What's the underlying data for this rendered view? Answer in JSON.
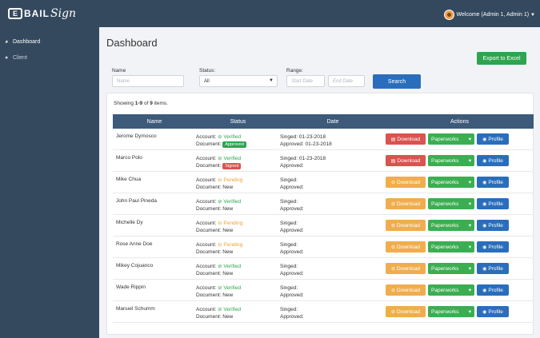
{
  "header": {
    "logo_mark": "E",
    "logo_text": "BAIL",
    "logo_script": "Sign",
    "welcome": "Welcome (Admin 1, Admin 1)"
  },
  "sidebar": {
    "items": [
      {
        "label": "Dashboard",
        "icon": "dashboard-icon"
      },
      {
        "label": "Client",
        "icon": "user-icon"
      }
    ]
  },
  "main": {
    "title": "Dashboard",
    "export_label": "Export to Excel",
    "filters": {
      "name_label": "Name",
      "name_placeholder": "Name",
      "status_label": "Status:",
      "status_value": "All",
      "range_label": "Range:",
      "start_placeholder": "Start Date",
      "end_placeholder": "End Date",
      "search_label": "Search"
    },
    "showing": {
      "prefix": "Showing ",
      "range": "1-9",
      "mid": " of ",
      "total": "9",
      "suffix": " items."
    },
    "table": {
      "columns": [
        "Name",
        "Status",
        "Date",
        "Actions"
      ],
      "account_label": "Account:",
      "document_label": "Document:",
      "singed_label": "Singed:",
      "approved_label": "Approved:",
      "download_label": "Download",
      "paperworks_label": "Paperworks",
      "profile_label": "Profile",
      "rows": [
        {
          "name": "Jerome Dymosco",
          "account": "Verified",
          "account_state": "ok",
          "document": "Approved",
          "doc_type": "badge-green",
          "singed": "01-23-2018",
          "approved": "01-23-2018",
          "download_style": "red"
        },
        {
          "name": "Marco Polo",
          "account": "Verified",
          "account_state": "ok",
          "document": "Signed",
          "doc_type": "badge-red",
          "singed": "01-23-2018",
          "approved": "",
          "download_style": "red"
        },
        {
          "name": "Mike Chua",
          "account": "Pending",
          "account_state": "warn",
          "document": "New",
          "doc_type": "text",
          "singed": "",
          "approved": "",
          "download_style": "orange"
        },
        {
          "name": "John Paul Pineda",
          "account": "Verified",
          "account_state": "ok",
          "document": "New",
          "doc_type": "text",
          "singed": "",
          "approved": "",
          "download_style": "orange"
        },
        {
          "name": "Michelle Dy",
          "account": "Pending",
          "account_state": "warn",
          "document": "New",
          "doc_type": "text",
          "singed": "",
          "approved": "",
          "download_style": "orange"
        },
        {
          "name": "Rose Anne Doe",
          "account": "Pending",
          "account_state": "warn",
          "document": "New",
          "doc_type": "text",
          "singed": "",
          "approved": "",
          "download_style": "orange"
        },
        {
          "name": "Mikey Cojuanco",
          "account": "Verified",
          "account_state": "ok",
          "document": "New",
          "doc_type": "text",
          "singed": "",
          "approved": "",
          "download_style": "orange"
        },
        {
          "name": "Wade Rippin",
          "account": "Verified",
          "account_state": "ok",
          "document": "New",
          "doc_type": "text",
          "singed": "",
          "approved": "",
          "download_style": "orange"
        },
        {
          "name": "Manuel Schumm",
          "account": "Verified",
          "account_state": "ok",
          "document": "New",
          "doc_type": "text",
          "singed": "",
          "approved": "",
          "download_style": "orange"
        }
      ]
    }
  },
  "colors": {
    "nav": "#34495e",
    "table_header": "#3d5a7a",
    "success": "#2ea44f",
    "danger": "#d9534f",
    "warning": "#f0ad4e",
    "primary": "#2a6ebb"
  }
}
